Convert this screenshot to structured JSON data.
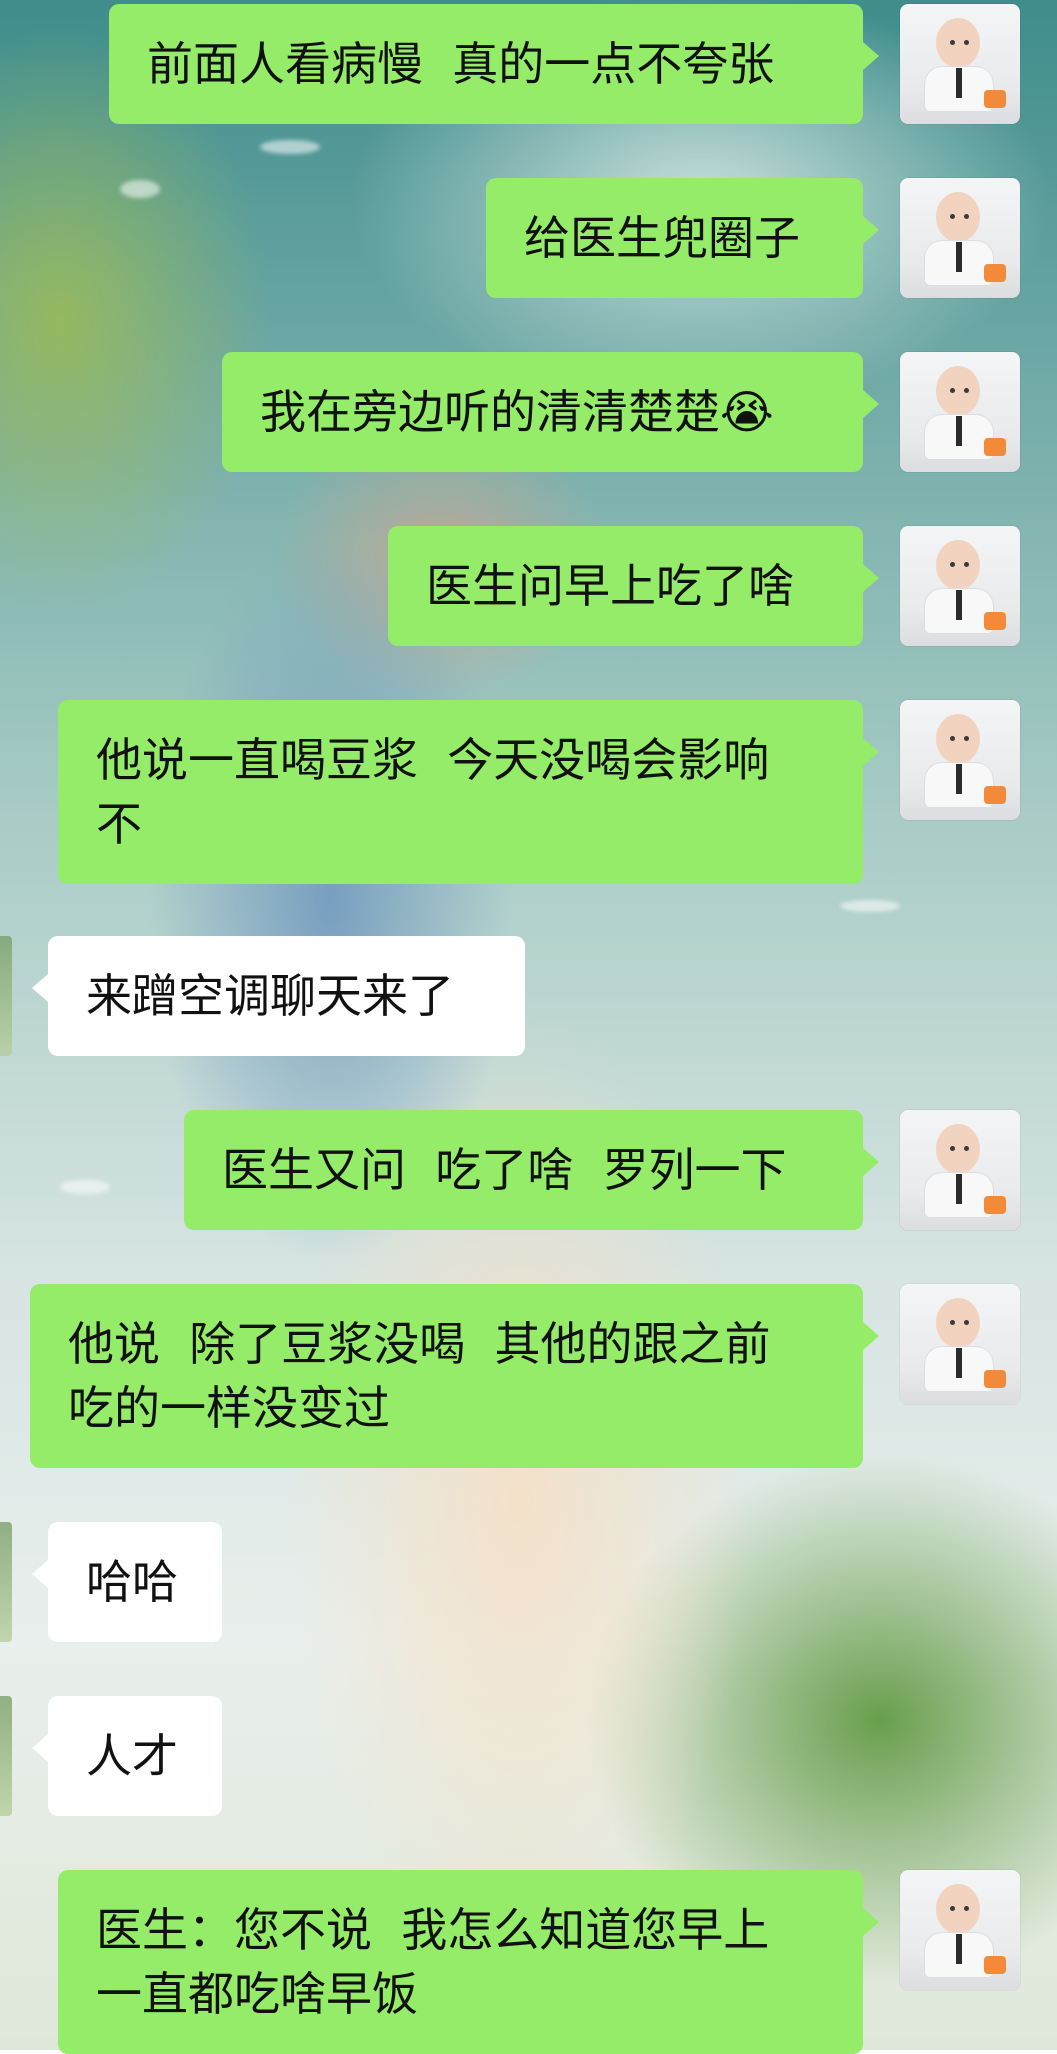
{
  "messages": [
    {
      "id": "m1",
      "direction": "out",
      "text": "前面人看病慢  真的一点不夸张"
    },
    {
      "id": "m2",
      "direction": "out",
      "text": "给医生兜圈子"
    },
    {
      "id": "m3",
      "direction": "out",
      "text": "我在旁边听的清清楚楚😭"
    },
    {
      "id": "m4",
      "direction": "out",
      "text": "医生问早上吃了啥"
    },
    {
      "id": "m5",
      "direction": "out",
      "text": "他说一直喝豆浆  今天没喝会影响\n不"
    },
    {
      "id": "m6",
      "direction": "in",
      "text": "来蹭空调聊天来了"
    },
    {
      "id": "m7",
      "direction": "out",
      "text": "医生又问  吃了啥  罗列一下"
    },
    {
      "id": "m8",
      "direction": "out",
      "text": "他说  除了豆浆没喝  其他的跟之前\n吃的一样没变过"
    },
    {
      "id": "m9",
      "direction": "in",
      "text": "哈哈"
    },
    {
      "id": "m10",
      "direction": "in",
      "text": "人才"
    },
    {
      "id": "m11",
      "direction": "out",
      "text": "医生：您不说  我怎么知道您早上\n一直都吃啥早饭"
    }
  ],
  "avatars": {
    "self": "baby-avatar",
    "other": "contact-avatar"
  },
  "colors": {
    "outgoing_bubble": "#95ec69",
    "incoming_bubble": "#ffffff",
    "text": "#111111"
  }
}
